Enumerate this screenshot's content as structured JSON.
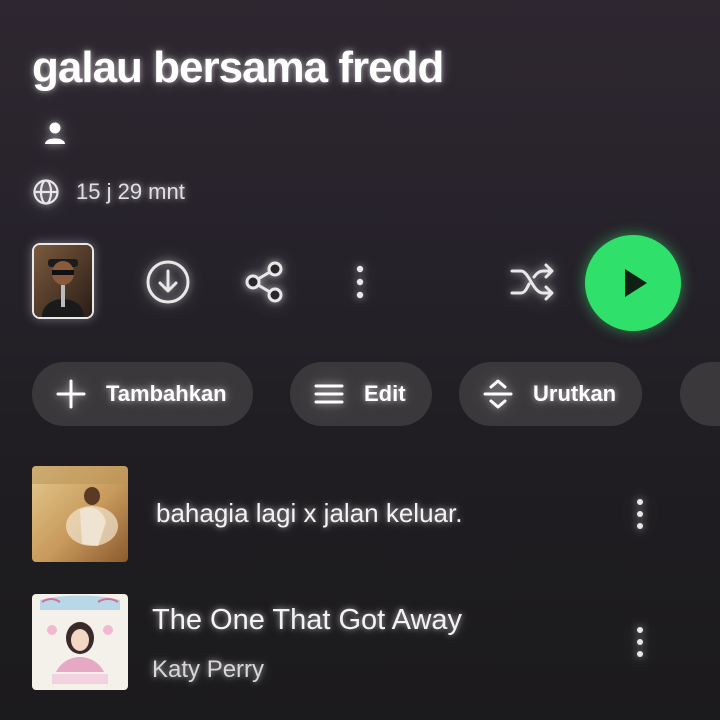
{
  "playlist": {
    "title": "galau bersama fredd",
    "duration": "15 j 29 mnt"
  },
  "controls": {
    "owner_icon": "user-icon",
    "globe_icon": "globe-icon",
    "download_icon": "download-icon",
    "share_icon": "share-icon",
    "more_icon": "more-vertical-icon",
    "shuffle_icon": "shuffle-icon",
    "play_icon": "play-icon",
    "accent_color": "#2fe06a"
  },
  "actions": [
    {
      "label": "Tambahkan",
      "icon": "plus-icon"
    },
    {
      "label": "Edit",
      "icon": "menu-icon"
    },
    {
      "label": "Urutkan",
      "icon": "sort-icon"
    }
  ],
  "tracks": [
    {
      "title": "bahagia lagi x jalan keluar.",
      "artist": ""
    },
    {
      "title": "The One That Got Away",
      "artist": "Katy Perry"
    }
  ]
}
